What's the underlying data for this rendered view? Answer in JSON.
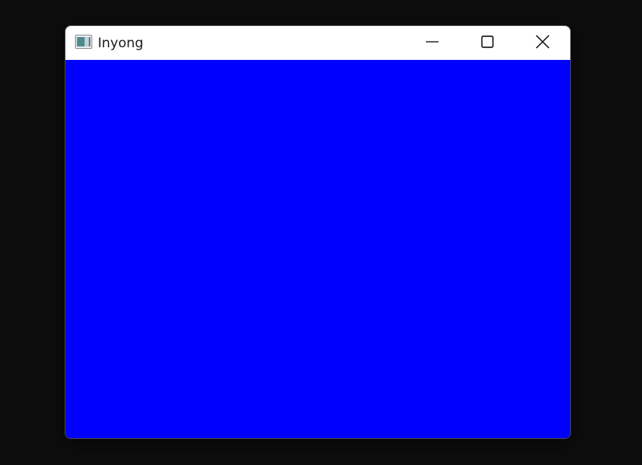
{
  "desktop": {
    "background_color": "#0d0d0d"
  },
  "window": {
    "title": "Inyong",
    "app_icon": "app-window-icon",
    "client_background_color": "#0000ff",
    "titlebar_color": "#ffffff",
    "controls": {
      "minimize_icon": "minimize-icon",
      "maximize_icon": "maximize-icon",
      "close_icon": "close-icon"
    }
  }
}
